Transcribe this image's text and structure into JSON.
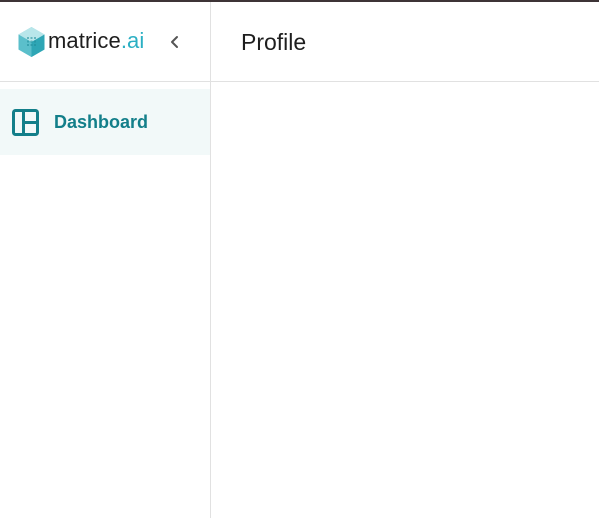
{
  "brand": {
    "name_main": "matrice",
    "name_suffix": ".ai",
    "accent_color": "#2bafc3",
    "logo_icon": "hexagon-cube-logo-icon",
    "collapse_icon": "chevron-left-icon"
  },
  "sidebar": {
    "items": [
      {
        "label": "Dashboard",
        "icon": "dashboard-layout-icon",
        "active": true,
        "color": "#137f8a"
      }
    ]
  },
  "header": {
    "title": "Profile"
  }
}
